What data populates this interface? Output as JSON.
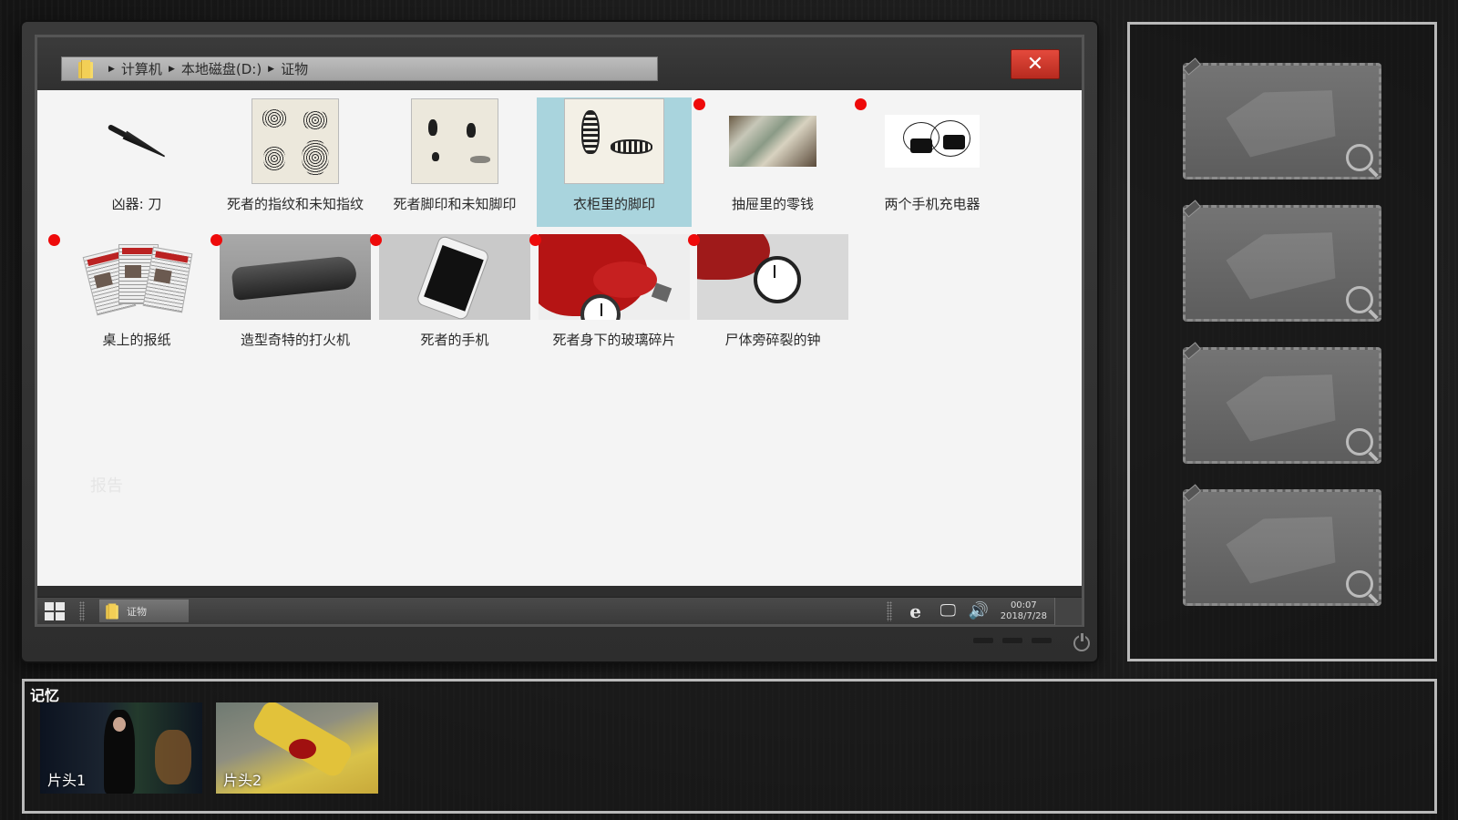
{
  "explorer": {
    "breadcrumb": [
      "计算机",
      "本地磁盘(D:)",
      "证物"
    ],
    "close_label": "✕",
    "files": [
      {
        "label": "凶器: 刀",
        "new": false,
        "selected": false
      },
      {
        "label": "死者的指纹和未知指纹",
        "new": false,
        "selected": false
      },
      {
        "label": "死者脚印和未知脚印",
        "new": false,
        "selected": false
      },
      {
        "label": "衣柜里的脚印",
        "new": false,
        "selected": true
      },
      {
        "label": "抽屉里的零钱",
        "new": true,
        "selected": false
      },
      {
        "label": "两个手机充电器",
        "new": true,
        "selected": false
      },
      {
        "label": "桌上的报纸",
        "new": true,
        "selected": false
      },
      {
        "label": "造型奇特的打火机",
        "new": true,
        "selected": false
      },
      {
        "label": "死者的手机",
        "new": true,
        "selected": false
      },
      {
        "label": "死者身下的玻璃碎片",
        "new": true,
        "selected": false
      },
      {
        "label": "尸体旁碎裂的钟",
        "new": true,
        "selected": false
      }
    ],
    "ghost_text": "报告"
  },
  "taskbar": {
    "task_label": "证物",
    "time": "00:07",
    "date": "2018/7/28",
    "tray_icons": [
      "ie-icon",
      "network-icon",
      "volume-icon"
    ]
  },
  "evidence_slots": {
    "count": 4,
    "state": "empty"
  },
  "memory": {
    "title": "记忆",
    "items": [
      {
        "label": "片头1"
      },
      {
        "label": "片头2"
      }
    ]
  },
  "colors": {
    "selected_bg": "#a9d4dd",
    "new_dot": "#ee0a0a",
    "close_red": "#d23a2d"
  }
}
